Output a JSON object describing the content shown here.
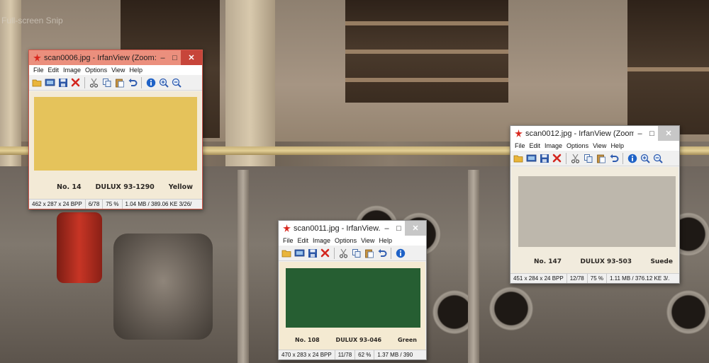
{
  "desktop": {
    "snip_label": "Full-screen Snip"
  },
  "menu_labels": [
    "File",
    "Edit",
    "Image",
    "Options",
    "View",
    "Help"
  ],
  "windows": [
    {
      "title": "scan0006.jpg - IrfanView (Zoom: ...",
      "active": true,
      "swatch": {
        "number": "No. 14",
        "code": "DULUX 93-1290",
        "name": "Yellow",
        "color": "#e5c35b",
        "paper": "#f3ead6"
      },
      "status": {
        "dims": "462 x 287 x 24 BPP",
        "index": "6/78",
        "zoom": "75 %",
        "size": "1.04 MB / 389.06 KE 3/26/"
      }
    },
    {
      "title": "scan0011.jpg - IrfanView...",
      "active": false,
      "swatch": {
        "number": "No. 108",
        "code": "DULUX 93-046",
        "name": "Green",
        "color": "#265e32",
        "paper": "#f4ead2"
      },
      "status": {
        "dims": "470 x 283 x 24 BPP",
        "index": "11/78",
        "zoom": "62 %",
        "size": "1.37 MB / 390"
      }
    },
    {
      "title": "scan0012.jpg - IrfanView (Zoom...",
      "active": false,
      "swatch": {
        "number": "No. 147",
        "code": "DULUX 93-503",
        "name": "Suede",
        "color": "#bdb7ac",
        "paper": "#f1ebdd"
      },
      "status": {
        "dims": "451 x 284 x 24 BPP",
        "index": "12/78",
        "zoom": "75 %",
        "size": "1.11 MB / 376.12 KE 3/."
      }
    }
  ],
  "colors": {
    "active_title": "#eb8f7d",
    "close_active": "#c7453a",
    "close_inactive": "#c7c7c7"
  },
  "icons": [
    "open-folder-icon",
    "slideshow-icon",
    "save-icon",
    "delete-icon",
    "cut-icon",
    "copy-icon",
    "paste-icon",
    "undo-icon",
    "info-icon",
    "zoom-in-icon",
    "zoom-out-icon"
  ]
}
